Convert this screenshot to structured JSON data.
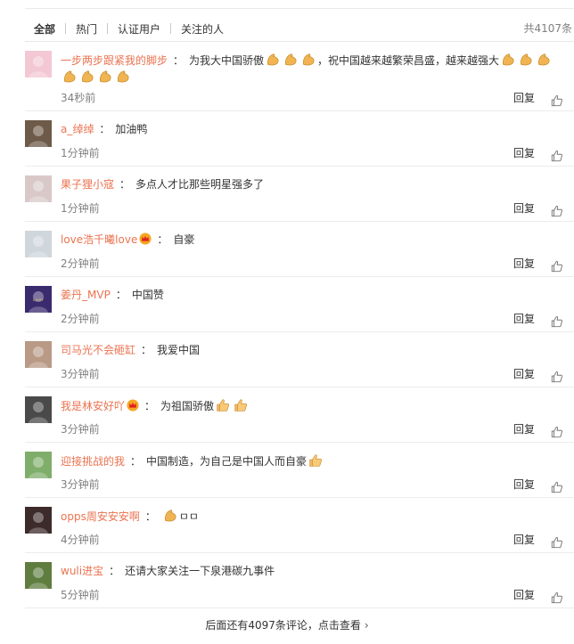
{
  "tabs": [
    "全部",
    "热门",
    "认证用户",
    "关注的人"
  ],
  "active_tab": "全部",
  "total_count": "共4107条",
  "reply_label": "回复",
  "comments": [
    {
      "user": "一步两步跟紧我的脚步",
      "text1": "为我大中国骄傲",
      "text2": "，祝中国越来越繁荣昌盛，越来越强大",
      "time": "34秒前",
      "avatar_color": "#f3c8d4",
      "emojis": "muscle"
    },
    {
      "user": "a_绰绰",
      "text1": "加油鸭",
      "time": "1分钟前",
      "avatar_color": "#6d5a48"
    },
    {
      "user": "果子狸小寇",
      "text1": "多点人才比那些明星强多了",
      "time": "1分钟前",
      "avatar_color": "#d8c9c8"
    },
    {
      "user": "love浩千曦love",
      "text1": "自豪",
      "time": "2分钟前",
      "avatar_color": "#cfd6dc",
      "crown": true
    },
    {
      "user": "姜丹_MVP",
      "text1": "中国赞",
      "time": "2分钟前",
      "avatar_color": "#3a2a6e",
      "avatar_text": "ᴸᴵᴹᴵᵀ"
    },
    {
      "user": "司马光不会砸缸",
      "text1": "我爱中国",
      "time": "3分钟前",
      "avatar_color": "#b89a86"
    },
    {
      "user": "我是林安好吖",
      "text1": "为祖国骄傲",
      "time": "3分钟前",
      "avatar_color": "#4a4a4a",
      "crown": true,
      "emojis": "thumb"
    },
    {
      "user": "迎接挑战的我",
      "text1": "中国制造，为自己是中国人而自豪",
      "time": "3分钟前",
      "avatar_color": "#7fae6a",
      "emojis": "thumb1"
    },
    {
      "user": "opps周安安安啊",
      "text1": "",
      "text_after": "ㅁㅁ",
      "time": "4分钟前",
      "avatar_color": "#3d2a2a",
      "emojis": "muscle1"
    },
    {
      "user": "wuli进宝",
      "text1": "还请大家关注一下泉港碳九事件",
      "time": "5分钟前",
      "avatar_color": "#5f7d3f"
    }
  ],
  "more_label": "后面还有4097条评论，点击查看"
}
